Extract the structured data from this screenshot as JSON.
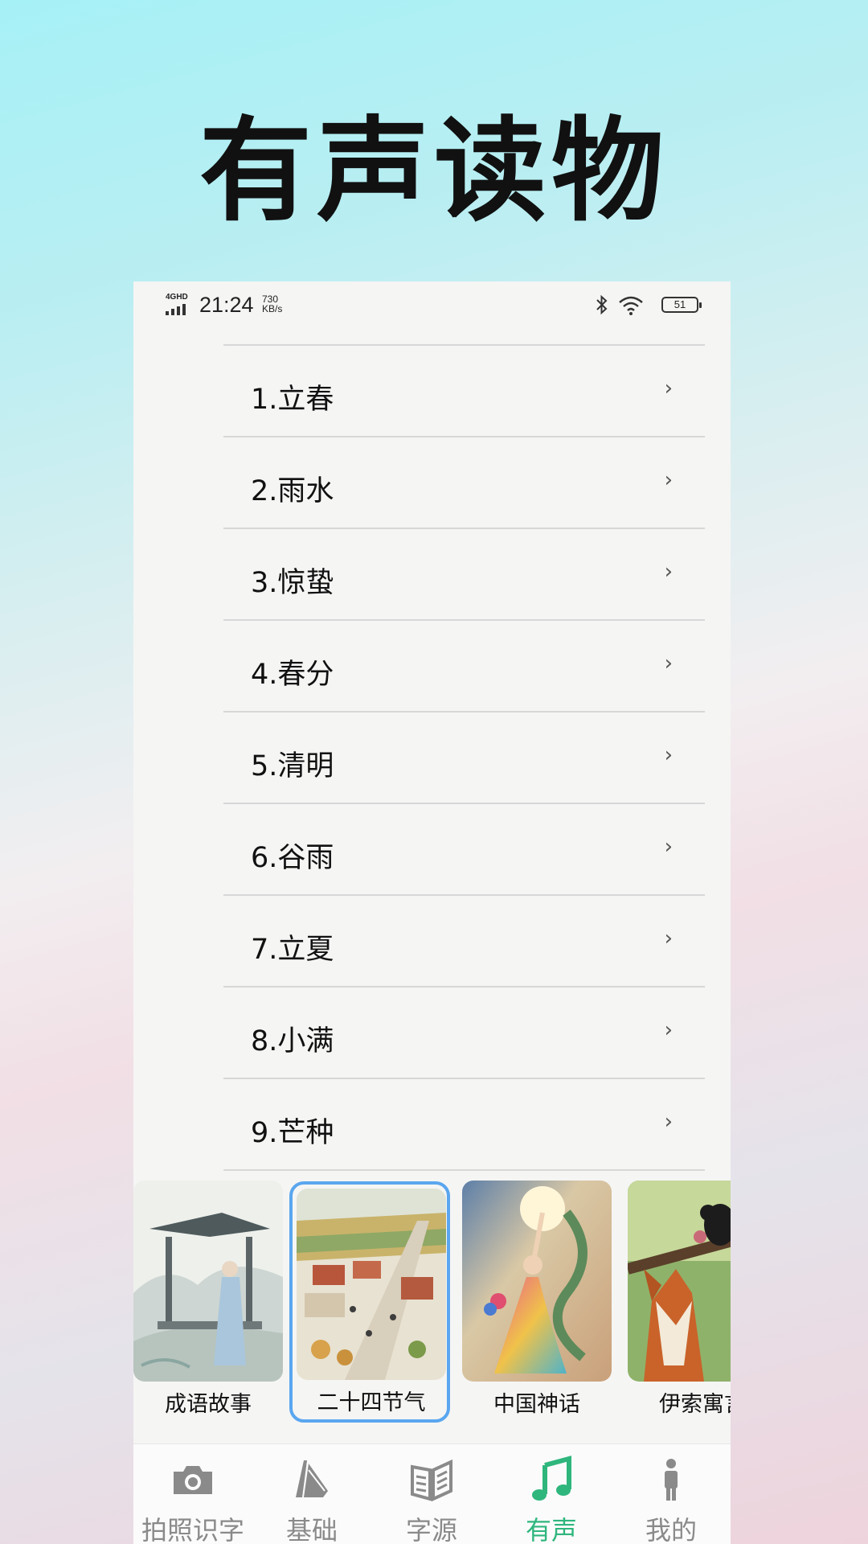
{
  "promo_title": "有声读物",
  "status_bar": {
    "network": "4GHD",
    "time": "21:24",
    "speed_value": "730",
    "speed_unit": "KB/s",
    "battery": "51"
  },
  "list": {
    "items": [
      {
        "label": "1.立春"
      },
      {
        "label": "2.雨水"
      },
      {
        "label": "3.惊蛰"
      },
      {
        "label": "4.春分"
      },
      {
        "label": "5.清明"
      },
      {
        "label": "6.谷雨"
      },
      {
        "label": "7.立夏"
      },
      {
        "label": "8.小满"
      },
      {
        "label": "9.芒种"
      }
    ],
    "chevron": "›"
  },
  "categories": [
    {
      "label": "成语故事",
      "icon": "ink-pavilion-scholar-image",
      "selected": false
    },
    {
      "label": "二十四节气",
      "icon": "village-harvest-image",
      "selected": true
    },
    {
      "label": "中国神话",
      "icon": "goddess-dragon-image",
      "selected": false
    },
    {
      "label": "伊索寓言",
      "icon": "fox-crow-image",
      "selected": false
    }
  ],
  "tabbar": {
    "tabs": [
      {
        "label": "拍照识字",
        "icon": "camera-icon",
        "active": false
      },
      {
        "label": "基础",
        "icon": "book-stack-icon",
        "active": false
      },
      {
        "label": "字源",
        "icon": "open-book-icon",
        "active": false
      },
      {
        "label": "有声",
        "icon": "music-note-icon",
        "active": true
      },
      {
        "label": "我的",
        "icon": "person-icon",
        "active": false
      }
    ],
    "active_color": "#2fb67d",
    "inactive_color": "#8a8a8a"
  }
}
